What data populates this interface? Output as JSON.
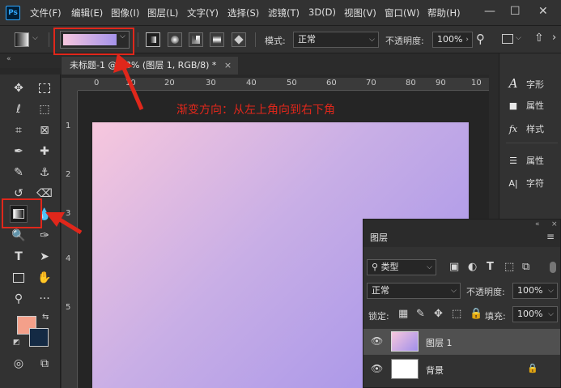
{
  "app": {
    "logo": "Ps",
    "menus": [
      "文件(F)",
      "编辑(E)",
      "图像(I)",
      "图层(L)",
      "文字(Y)",
      "选择(S)",
      "滤镜(T)",
      "3D(D)",
      "视图(V)",
      "窗口(W)",
      "帮助(H)"
    ],
    "window_controls": [
      "—",
      "☐",
      "✕"
    ]
  },
  "options": {
    "mode_label": "模式:",
    "mode_value": "正常",
    "opacity_label": "不透明度:",
    "opacity_value": "100%",
    "gradient_start": "#f6c6de",
    "gradient_end": "#a593ea"
  },
  "document": {
    "tab_title": "未标题-1 @ 93% (图层 1, RGB/8) *",
    "tab_close": "×",
    "ruler_h": [
      "0",
      "10",
      "20",
      "30",
      "40",
      "50",
      "60",
      "70",
      "80",
      "90",
      "10"
    ],
    "ruler_v": [
      "1",
      "2",
      "3",
      "4",
      "5"
    ]
  },
  "annotation": {
    "text": "渐变方向：从左上角向到右下角",
    "color": "#e0271b"
  },
  "right_panel": {
    "items": [
      {
        "icon": "A",
        "label": "字形"
      },
      {
        "icon": "■",
        "label": "属性"
      },
      {
        "icon": "fx",
        "label": "样式"
      },
      {
        "icon": "☰",
        "label": "属性"
      },
      {
        "icon": "A|",
        "label": "字符"
      }
    ]
  },
  "layers_panel": {
    "title": "图层",
    "filter_kind": "类型",
    "blend_mode": "正常",
    "opacity_label": "不透明度:",
    "opacity_value": "100%",
    "lock_label": "锁定:",
    "fill_label": "填充:",
    "fill_value": "100%",
    "layers": [
      {
        "name": "图层 1",
        "selected": true
      },
      {
        "name": "背景",
        "locked": true
      }
    ]
  },
  "colors": {
    "foreground": "#f4a08a",
    "background": "#142a44",
    "canvas_top_left": "#f7c7dd",
    "canvas_bottom_right": "#a190ea"
  }
}
